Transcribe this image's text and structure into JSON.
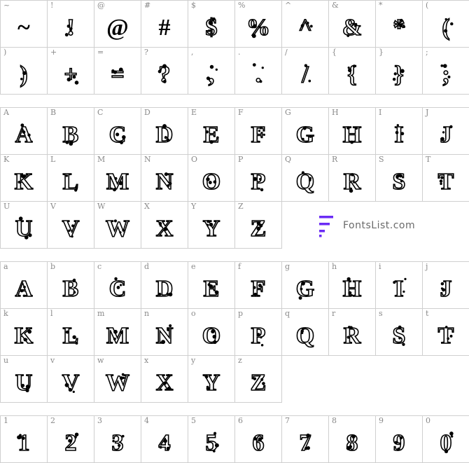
{
  "logo_text": "FontsList.com",
  "sections": [
    {
      "rows": [
        [
          {
            "key": "~",
            "glyph": "~",
            "solid": true
          },
          {
            "key": "!",
            "glyph": "!"
          },
          {
            "key": "@",
            "glyph": "@",
            "solid": true
          },
          {
            "key": "#",
            "glyph": "#",
            "solid": true
          },
          {
            "key": "$",
            "glyph": "$"
          },
          {
            "key": "%",
            "glyph": "%"
          },
          {
            "key": "^",
            "glyph": "^"
          },
          {
            "key": "&",
            "glyph": "&"
          },
          {
            "key": "*",
            "glyph": "*"
          },
          {
            "key": "(",
            "glyph": "("
          }
        ],
        [
          {
            "key": ")",
            "glyph": ")"
          },
          {
            "key": "+",
            "glyph": "+"
          },
          {
            "key": "=",
            "glyph": "="
          },
          {
            "key": "?",
            "glyph": "?"
          },
          {
            "key": ",",
            "glyph": ","
          },
          {
            "key": ".",
            "glyph": "."
          },
          {
            "key": "/",
            "glyph": "/"
          },
          {
            "key": "{",
            "glyph": "{"
          },
          {
            "key": "}",
            "glyph": "}"
          },
          {
            "key": ";",
            "glyph": ";"
          }
        ]
      ]
    },
    {
      "rows": [
        [
          {
            "key": "A",
            "glyph": "A"
          },
          {
            "key": "B",
            "glyph": "B"
          },
          {
            "key": "C",
            "glyph": "C"
          },
          {
            "key": "D",
            "glyph": "D"
          },
          {
            "key": "E",
            "glyph": "E"
          },
          {
            "key": "F",
            "glyph": "F"
          },
          {
            "key": "G",
            "glyph": "G"
          },
          {
            "key": "H",
            "glyph": "H"
          },
          {
            "key": "I",
            "glyph": "I"
          },
          {
            "key": "J",
            "glyph": "J"
          }
        ],
        [
          {
            "key": "K",
            "glyph": "K"
          },
          {
            "key": "L",
            "glyph": "L"
          },
          {
            "key": "M",
            "glyph": "M"
          },
          {
            "key": "N",
            "glyph": "N"
          },
          {
            "key": "O",
            "glyph": "O"
          },
          {
            "key": "P",
            "glyph": "P"
          },
          {
            "key": "Q",
            "glyph": "Q"
          },
          {
            "key": "R",
            "glyph": "R"
          },
          {
            "key": "S",
            "glyph": "S"
          },
          {
            "key": "T",
            "glyph": "T"
          }
        ],
        [
          {
            "key": "U",
            "glyph": "U"
          },
          {
            "key": "V",
            "glyph": "V"
          },
          {
            "key": "W",
            "glyph": "W"
          },
          {
            "key": "X",
            "glyph": "X"
          },
          {
            "key": "Y",
            "glyph": "Y"
          },
          {
            "key": "Z",
            "glyph": "Z"
          }
        ]
      ]
    },
    {
      "rows": [
        [
          {
            "key": "a",
            "glyph": "A"
          },
          {
            "key": "b",
            "glyph": "B"
          },
          {
            "key": "c",
            "glyph": "C"
          },
          {
            "key": "d",
            "glyph": "D"
          },
          {
            "key": "e",
            "glyph": "E"
          },
          {
            "key": "f",
            "glyph": "F"
          },
          {
            "key": "g",
            "glyph": "G"
          },
          {
            "key": "h",
            "glyph": "H"
          },
          {
            "key": "i",
            "glyph": "I"
          },
          {
            "key": "j",
            "glyph": "J"
          }
        ],
        [
          {
            "key": "k",
            "glyph": "K"
          },
          {
            "key": "l",
            "glyph": "L"
          },
          {
            "key": "m",
            "glyph": "M"
          },
          {
            "key": "n",
            "glyph": "N"
          },
          {
            "key": "o",
            "glyph": "O"
          },
          {
            "key": "p",
            "glyph": "P"
          },
          {
            "key": "q",
            "glyph": "Q"
          },
          {
            "key": "r",
            "glyph": "R"
          },
          {
            "key": "s",
            "glyph": "S"
          },
          {
            "key": "t",
            "glyph": "T"
          }
        ],
        [
          {
            "key": "u",
            "glyph": "U"
          },
          {
            "key": "v",
            "glyph": "V"
          },
          {
            "key": "w",
            "glyph": "W"
          },
          {
            "key": "x",
            "glyph": "X"
          },
          {
            "key": "y",
            "glyph": "Y"
          },
          {
            "key": "z",
            "glyph": "Z"
          }
        ]
      ]
    },
    {
      "rows": [
        [
          {
            "key": "1",
            "glyph": "1"
          },
          {
            "key": "2",
            "glyph": "2"
          },
          {
            "key": "3",
            "glyph": "3"
          },
          {
            "key": "4",
            "glyph": "4"
          },
          {
            "key": "5",
            "glyph": "5"
          },
          {
            "key": "6",
            "glyph": "6"
          },
          {
            "key": "7",
            "glyph": "7"
          },
          {
            "key": "8",
            "glyph": "8"
          },
          {
            "key": "9",
            "glyph": "9"
          },
          {
            "key": "0",
            "glyph": "0"
          }
        ]
      ]
    }
  ]
}
